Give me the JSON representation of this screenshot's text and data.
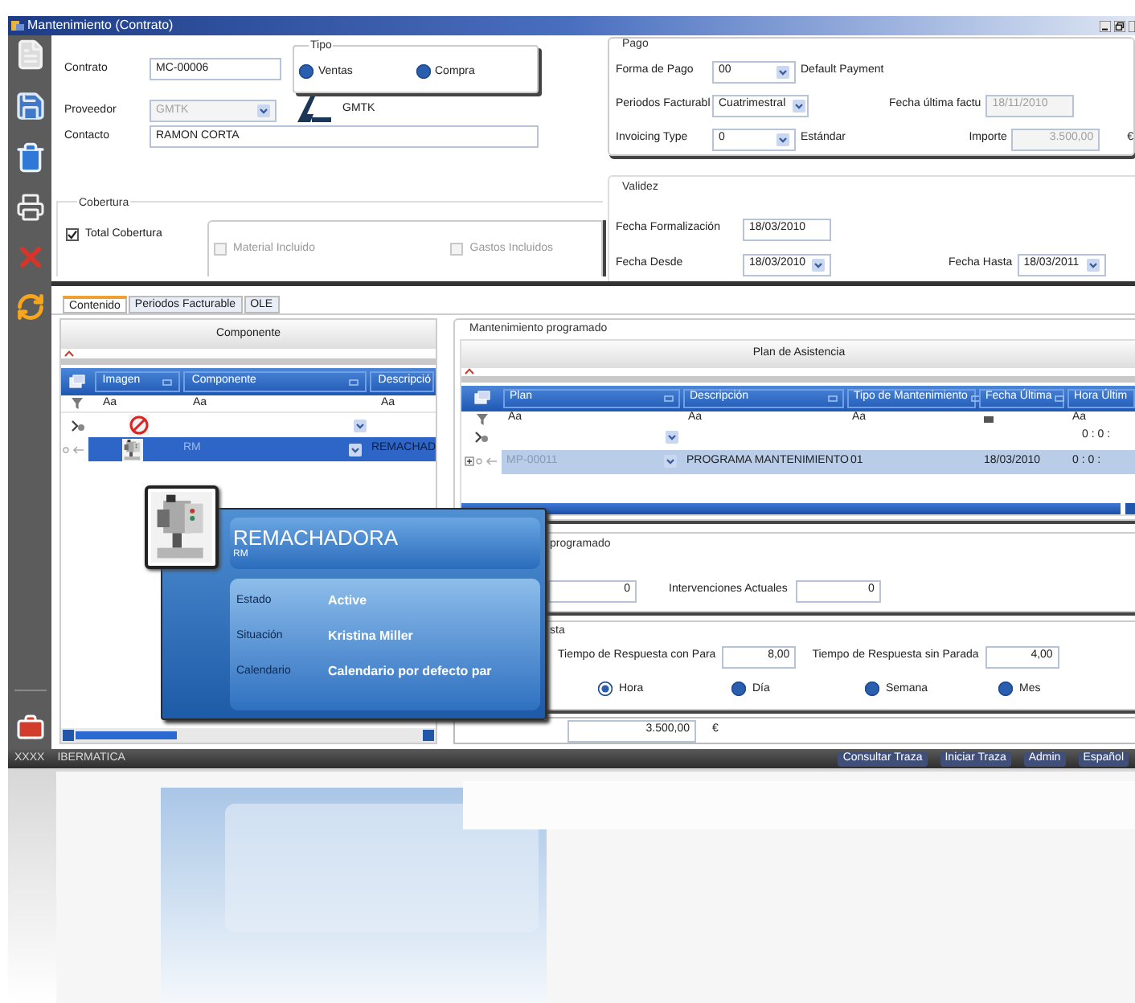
{
  "window": {
    "title": "Mantenimiento (Contrato)"
  },
  "contract": {
    "contrato": {
      "label": "Contrato",
      "value": "MC-00006"
    },
    "proveedor": {
      "label": "Proveedor",
      "value": "GMTK",
      "name": "GMTK",
      "disabled": true
    },
    "contacto": {
      "label": "Contacto",
      "value": "RAMON CORTA"
    }
  },
  "tipo": {
    "title": "Tipo",
    "options": [
      {
        "label": "Ventas",
        "selected": false
      },
      {
        "label": "Compra",
        "selected": false
      }
    ]
  },
  "cobertura": {
    "title": "Cobertura",
    "checks": [
      {
        "label": "Total Cobertura",
        "checked": true,
        "disabled": false
      },
      {
        "label": "Material Incluido",
        "checked": false,
        "disabled": true
      },
      {
        "label": "Gastos Incluidos",
        "checked": false,
        "disabled": true
      }
    ]
  },
  "pago": {
    "title": "Pago",
    "forma": {
      "label": "Forma de Pago",
      "value": "00",
      "note": "Default Payment"
    },
    "periodos": {
      "label": "Periodos Facturabl",
      "value": "Cuatrimestral"
    },
    "fecha_ultima": {
      "label": "Fecha última factu",
      "value": "18/11/2010"
    },
    "invoicing": {
      "label": "Invoicing Type",
      "value": "0",
      "note": "Estándar"
    },
    "importe": {
      "label": "Importe",
      "value": "3.500,00",
      "currency": "€"
    }
  },
  "validez": {
    "title": "Validez",
    "formalizacion": {
      "label": "Fecha Formalización",
      "value": "18/03/2010"
    },
    "desde": {
      "label": "Fecha Desde",
      "value": "18/03/2010"
    },
    "hasta": {
      "label": "Fecha Hasta",
      "value": "18/03/2011"
    }
  },
  "tabs": [
    {
      "label": "Contenido",
      "selected": true
    },
    {
      "label": "Periodos Facturable",
      "selected": false
    },
    {
      "label": "OLE",
      "selected": false
    }
  ],
  "componente_grid": {
    "title": "Componente",
    "columns": [
      "Imagen",
      "Componente",
      "Descripció"
    ],
    "filters": [
      {
        "kind": "text",
        "text": "Aa"
      },
      {
        "kind": "text",
        "text": "Aa"
      },
      {
        "kind": "text",
        "text": "Aa"
      }
    ],
    "rows": [
      {
        "componente": "RM",
        "descripcion": "REMACHAD",
        "selected": true
      }
    ]
  },
  "plan_grid": {
    "group": "Mantenimiento programado",
    "title": "Plan de Asistencia",
    "columns": [
      "Plan",
      "Descripción",
      "Tipo de Mantenimiento",
      "Fecha Última",
      "Hora Últim"
    ],
    "filters": [
      {
        "kind": "text",
        "text": "Aa"
      },
      {
        "kind": "text",
        "text": "Aa"
      },
      {
        "kind": "text",
        "text": "Aa"
      },
      {
        "kind": "icon"
      },
      {
        "kind": "text",
        "text": "Aa"
      }
    ],
    "new_row_time": "0 : 0 :",
    "rows": [
      {
        "plan": "MP-00011",
        "descripcion": "PROGRAMA MANTENIMIENTO",
        "tipo": "01",
        "fecha": "18/03/2010",
        "hora": "0 : 0 :",
        "selected": true
      }
    ]
  },
  "intervenciones": {
    "title": "programado",
    "previstas": "0",
    "actuales": {
      "label": "Intervenciones Actuales",
      "value": "0"
    }
  },
  "respuesta": {
    "title": "sta",
    "con_parada": {
      "label": "Tiempo de Respuesta con Para",
      "value": "8,00"
    },
    "sin_parada": {
      "label": "Tiempo de Respuesta sin Parada",
      "value": "4,00"
    },
    "units": [
      {
        "label": "Hora",
        "selected": true
      },
      {
        "label": "Día",
        "selected": false
      },
      {
        "label": "Semana",
        "selected": false
      },
      {
        "label": "Mes",
        "selected": false
      }
    ]
  },
  "importe": {
    "value": "3.500,00",
    "currency": "€"
  },
  "popup": {
    "title": "REMACHADORA",
    "subtitle": "RM",
    "fields": [
      {
        "label": "Estado",
        "value": "Active"
      },
      {
        "label": "Situación",
        "value": "Kristina Miller"
      },
      {
        "label": "Calendario",
        "value": "Calendario por defecto par"
      }
    ]
  },
  "status_bar": {
    "left": [
      "XXXX",
      "IBERMATICA"
    ],
    "right": [
      "Consultar Traza",
      "Iniciar Traza",
      "Admin",
      "Español"
    ]
  }
}
